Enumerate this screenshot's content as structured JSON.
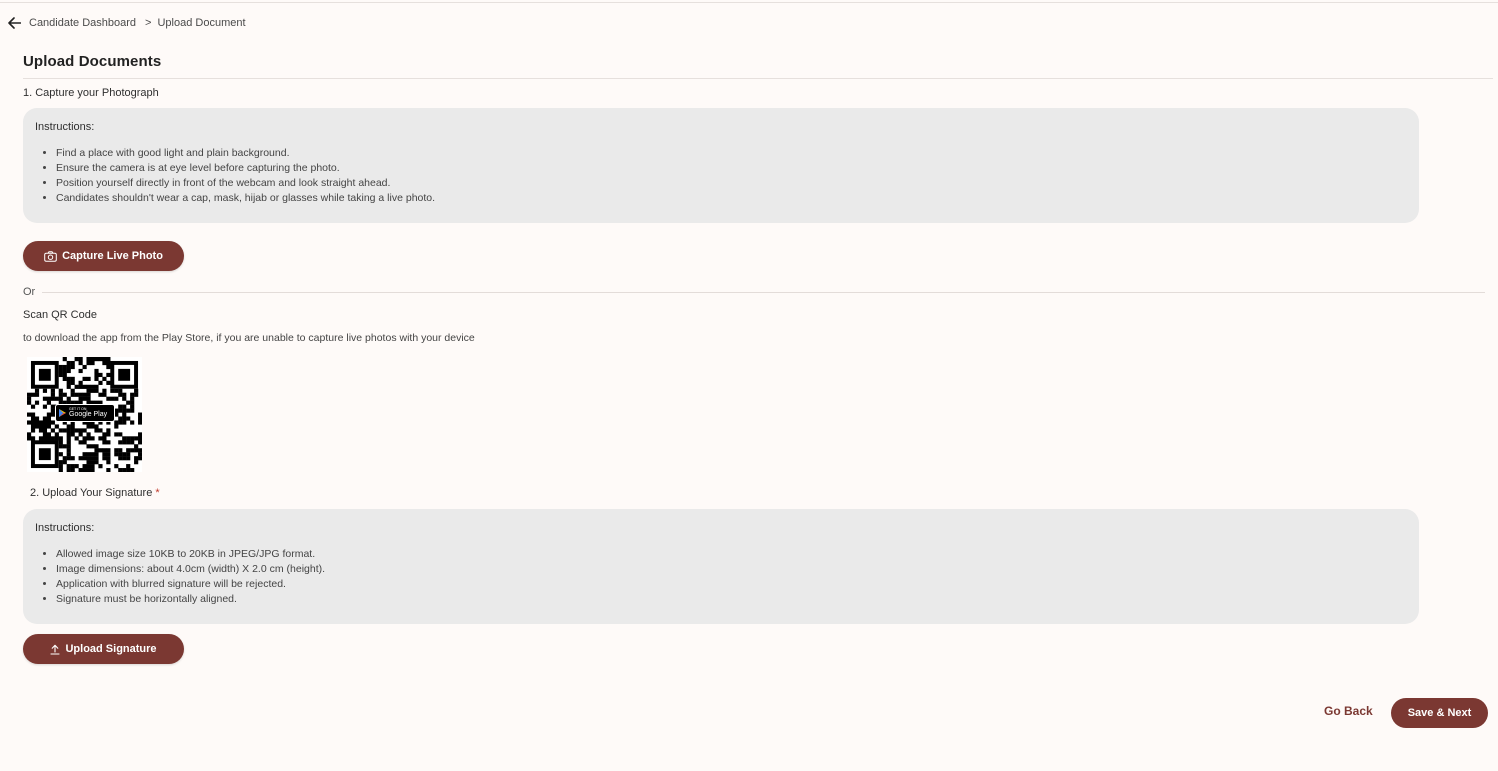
{
  "breadcrumb": {
    "dashboard": "Candidate Dashboard",
    "separator": ">",
    "current": "Upload Document"
  },
  "page": {
    "title": "Upload Documents"
  },
  "photo_section": {
    "label": "1. Capture your Photograph",
    "instructions_title": "Instructions:",
    "instructions": [
      "Find a place with good light and plain background.",
      "Ensure the camera is at eye level before capturing the photo.",
      "Position yourself directly in front of the webcam and look straight ahead.",
      "Candidates shouldn't wear a cap, mask, hijab or glasses while taking a live photo."
    ],
    "capture_button": "Capture Live Photo",
    "capture_icon": "camera-icon"
  },
  "or_divider": "Or",
  "qr_section": {
    "title": "Scan QR Code",
    "description": "to download the app from the Play Store, if you are unable to capture live photos with your device",
    "badge_small": "GET IT ON",
    "badge_big": "Google Play"
  },
  "signature_section": {
    "label": "2. Upload Your Signature",
    "required_mark": "*",
    "instructions_title": "Instructions:",
    "instructions": [
      "Allowed image size 10KB to 20KB in JPEG/JPG format.",
      "Image dimensions: about 4.0cm (width) X 2.0 cm (height).",
      "Application with blurred signature will be rejected.",
      "Signature must be horizontally aligned."
    ],
    "upload_button": "Upload Signature",
    "upload_icon": "upload-icon"
  },
  "footer": {
    "go_back": "Go Back",
    "save_next": "Save & Next"
  },
  "colors": {
    "primary": "#7b3832",
    "background": "#fefaf8",
    "panel": "#eaeaea"
  }
}
